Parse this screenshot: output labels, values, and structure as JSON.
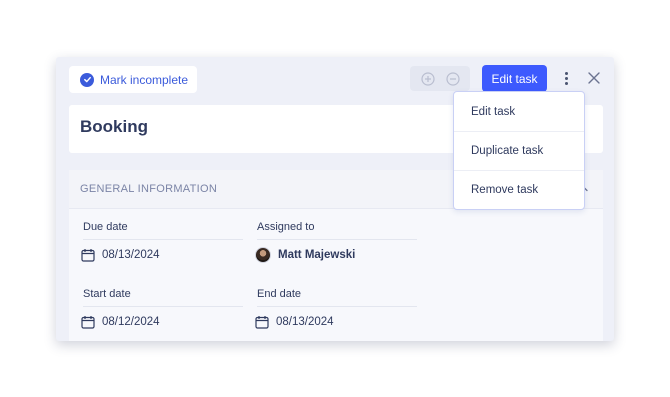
{
  "toolbar": {
    "mark_incomplete_label": "Mark incomplete",
    "edit_task_label": "Edit task"
  },
  "task": {
    "title": "Booking"
  },
  "general_information": {
    "section_title": "GENERAL INFORMATION",
    "fields": {
      "due_date": {
        "label": "Due date",
        "value": "08/13/2024"
      },
      "assigned_to": {
        "label": "Assigned to",
        "value": "Matt Majewski"
      },
      "start_date": {
        "label": "Start date",
        "value": "08/12/2024"
      },
      "end_date": {
        "label": "End date",
        "value": "08/13/2024"
      }
    }
  },
  "dropdown_menu": {
    "items": [
      "Edit task",
      "Duplicate task",
      "Remove task"
    ]
  },
  "colors": {
    "accent": "#3d5afe",
    "panel_bg": "#eef0f8",
    "text_primary": "#2f3a5e",
    "text_muted": "#7b84a6"
  }
}
